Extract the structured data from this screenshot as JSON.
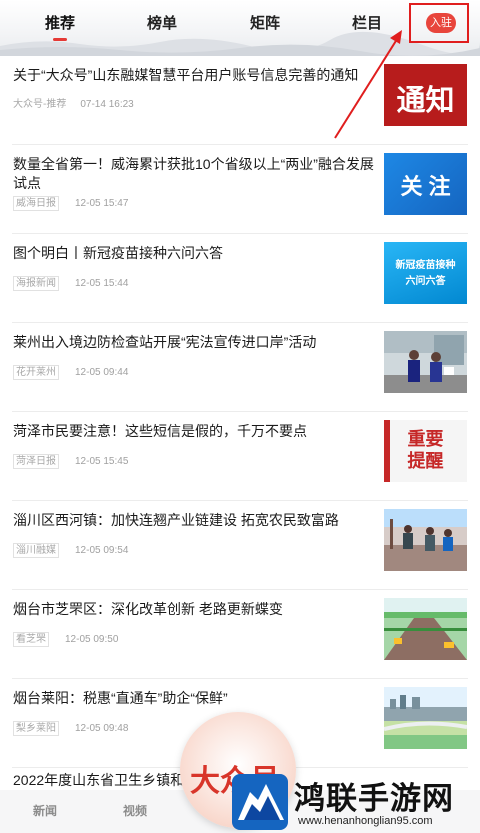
{
  "tabs": [
    {
      "label": "推荐",
      "active": true
    },
    {
      "label": "榜单",
      "active": false
    },
    {
      "label": "矩阵",
      "active": false
    },
    {
      "label": "栏目",
      "active": false
    }
  ],
  "join_button": "入驻",
  "feed": [
    {
      "title": "关于“大众号”山东融媒智慧平台用户账号信息完善的通知",
      "source": "大众号-推荐",
      "time": "07-14 16:23",
      "thumb_text": "通知"
    },
    {
      "title": "数量全省第一！威海累计获批10个省级以上“两业”融合发展试点",
      "source": "威海日报",
      "time": "12-05 15:47",
      "thumb_text": "关 注"
    },
    {
      "title": "图个明白丨新冠疫苗接种六问六答",
      "source": "海报新闻",
      "time": "12-05 15:44",
      "thumb_text": "新冠疫苗接种\n六问六答"
    },
    {
      "title": "莱州出入境边防检查站开展“宪法宣传进口岸”活动",
      "source": "花开莱州",
      "time": "12-05 09:44",
      "thumb_text": ""
    },
    {
      "title": "菏泽市民要注意！这些短信是假的，千万不要点",
      "source": "菏泽日报",
      "time": "12-05 15:45",
      "thumb_text": "重要\n提醒"
    },
    {
      "title": "淄川区西河镇：加快连翘产业链建设 拓宽农民致富路",
      "source": "淄川融媒",
      "time": "12-05 09:54",
      "thumb_text": ""
    },
    {
      "title": "烟台市芝罘区：深化改革创新 老路更新蝶变",
      "source": "看芝罘",
      "time": "12-05 09:50",
      "thumb_text": ""
    },
    {
      "title": "烟台莱阳：税惠“直通车”助企“保鲜”",
      "source": "梨乡莱阳",
      "time": "12-05 09:48",
      "thumb_text": ""
    }
  ],
  "last_title_partial": "2022年度山东省卫生乡镇和",
  "bottom_tabs": [
    "新闻",
    "视频"
  ],
  "float_badge": "大众号",
  "watermark": {
    "text": "鸿联手游网",
    "url": "www.henanhonglian95.com"
  },
  "colors": {
    "accent": "#e53935",
    "join": "#e8453c",
    "highlight_box": "#e01e1e"
  }
}
